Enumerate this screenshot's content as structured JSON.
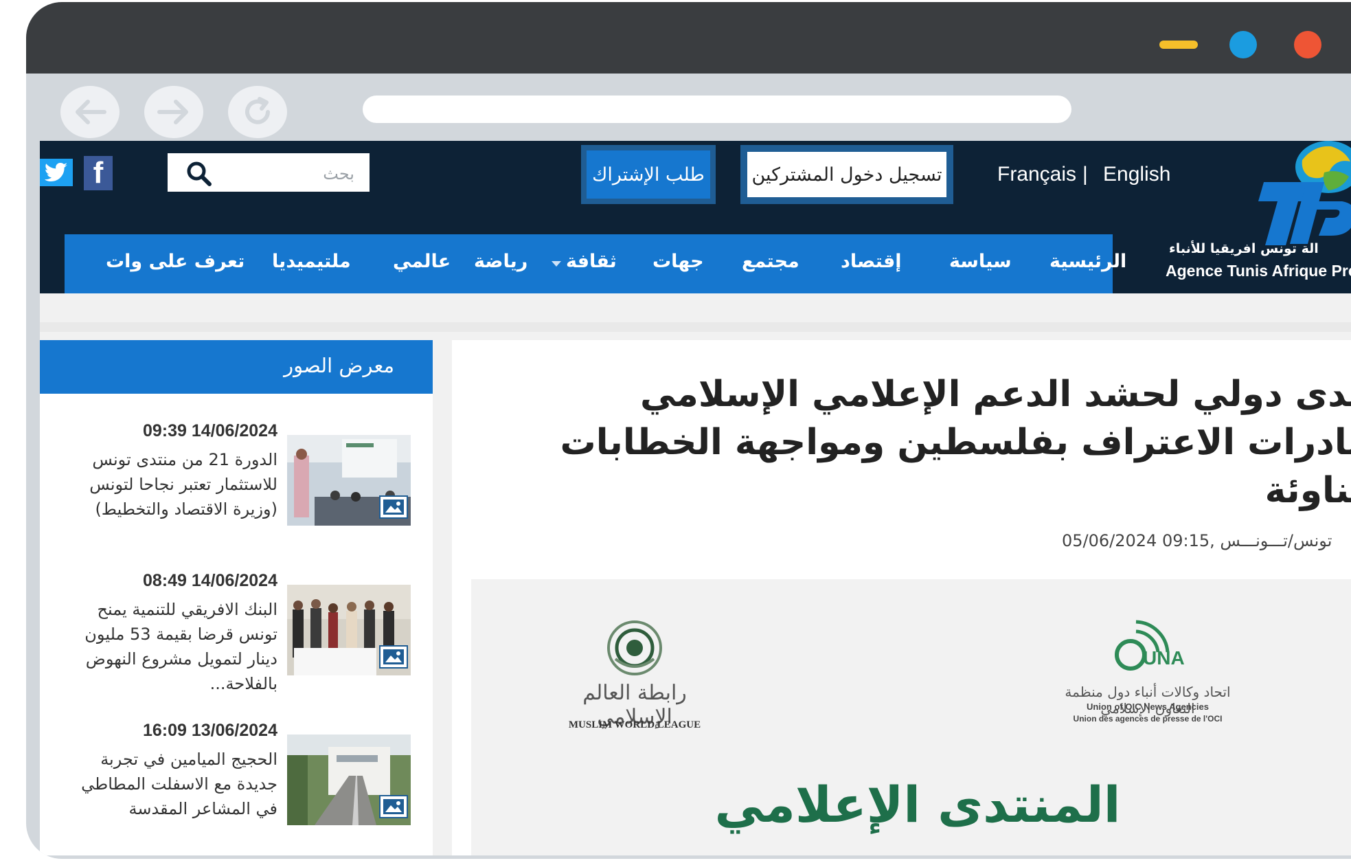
{
  "header": {
    "search_placeholder": "بحث",
    "subscribe_button": "طلب الإشتراك",
    "login_button": "تسجيل دخول المشتركين",
    "lang_fr": "Français",
    "lang_sep": "|",
    "lang_en": "English",
    "logo_ar": "الة تونس افريقيا للأنباء",
    "logo_en": "Agence Tunis Afrique Pres"
  },
  "menu": {
    "items": [
      "الرئيسية",
      "سياسة",
      "إقتصاد",
      "مجتمع",
      "جهات",
      "ثقافة",
      "رياضة",
      "عالمي",
      "ملتيميديا",
      "تعرف على وات"
    ]
  },
  "sidebar": {
    "title": "معرض الصور",
    "items": [
      {
        "date": "09:39 14/06/2024",
        "text": "الدورة 21 من منتدى تونس للاستثمار تعتبر نجاحا لتونس (وزيرة الاقتصاد والتخطيط)"
      },
      {
        "date": "08:49 14/06/2024",
        "text": "البنك الافريقي للتنمية يمنح تونس قرضا بقيمة 53 مليون دينار لتمويل مشروع النهوض بالفلاحة..."
      },
      {
        "date": "16:09 13/06/2024",
        "text": "الحجيج الميامين في تجربة جديدة مع الاسفلت المطاطي في المشاعر المقدسة"
      }
    ]
  },
  "article": {
    "headline": "منتدى دولي لحشد الدعم الإعلامي الإسلامي لمبادرات الاعتراف بفلسطين ومواجهة الخطابات المناوئة",
    "dateline": "05/06/2024 09:15, تونس/تـــونـــس",
    "image": {
      "una_ar": "اتحاد وكالات أنباء دول منظمة التعاون الإسلامي",
      "una_en1": "Union of OIC News Agencies",
      "una_en2": "Union des agences de presse de l'OCI",
      "una_mark": "UNA",
      "mwl_ar": "رابطة العالم الإسلامي",
      "mwl_en": "MUSLIM WORLD LEAGUE",
      "big_title": "المنتدى الإعلامي"
    }
  },
  "colors": {
    "header_bg": "#0d2236",
    "menu_blue": "#1677cf",
    "title_green": "#1e6f4a"
  }
}
